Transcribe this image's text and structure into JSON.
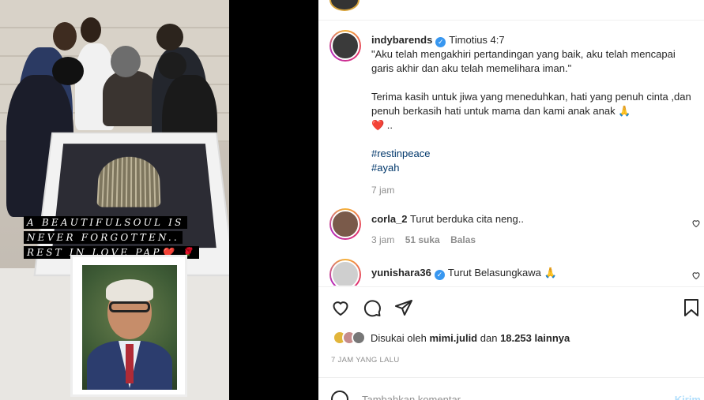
{
  "photo": {
    "caption_lines": [
      "A BEAUTIFULSOUL IS",
      "NEVER FORGOTTEN..",
      "REST IN LOVE PAP❤️ 🌹"
    ]
  },
  "post": {
    "username": "indybarends",
    "verse": "Timotius 4:7",
    "quote": "\"Aku telah mengakhiri pertandingan yang baik, aku telah mencapai garis akhir dan aku telah memelihara iman.\"",
    "message": "Terima kasih untuk jiwa yang meneduhkan, hati yang penuh cinta ,dan penuh berkasih hati untuk mama dan kami anak anak 🙏",
    "heart_line": "❤️ ..",
    "hashtags": [
      "#restinpeace",
      "#ayah"
    ],
    "time": "7 jam"
  },
  "comments": [
    {
      "username": "corla_2",
      "text": "Turut berduka cita neng..",
      "time": "3 jam",
      "likes": "51 suka",
      "reply": "Balas",
      "verified": false
    },
    {
      "username": "yunishara36",
      "text": "Turut Belasungkawa 🙏",
      "verified": true
    }
  ],
  "likes": {
    "prefix": "Disukai oleh",
    "user": "mimi.julid",
    "connector": "dan",
    "count": "18.253 lainnya"
  },
  "posted_ago": "7 JAM YANG LALU",
  "comment_input": {
    "placeholder": "Tambahkan komentar...",
    "post_label": "Kirim"
  },
  "icons": {
    "like": "heart-icon",
    "comment": "comment-icon",
    "share": "share-icon",
    "save": "bookmark-icon",
    "emoji": "emoji-icon"
  }
}
